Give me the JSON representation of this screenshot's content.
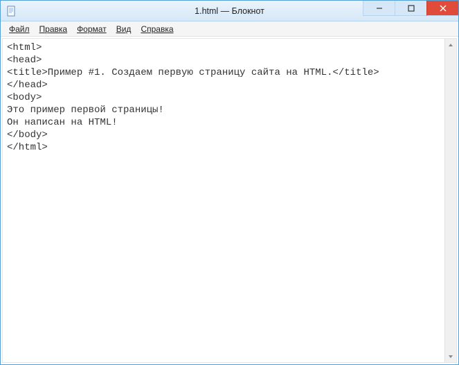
{
  "window": {
    "title": "1.html — Блокнот"
  },
  "menu": {
    "file": "Файл",
    "edit": "Правка",
    "format": "Формат",
    "view": "Вид",
    "help": "Справка"
  },
  "content": "<html>\n<head>\n<title>Пример #1. Создаем первую страницу сайта на HTML.</title>\n</head>\n<body>\nЭто пример первой страницы!\nОн написан на HTML!\n</body>\n</html>"
}
